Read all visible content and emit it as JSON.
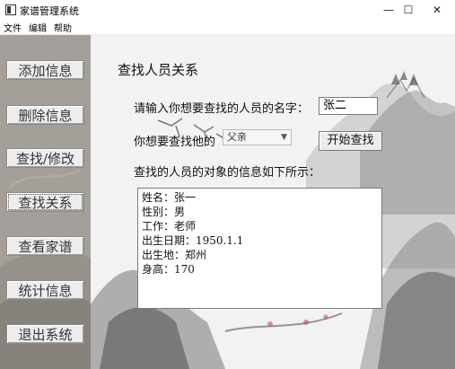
{
  "window": {
    "title": "家谱管理系统",
    "minimize": "—",
    "maximize": "☐",
    "close": "✕"
  },
  "menu": [
    "文件",
    "编辑",
    "帮助"
  ],
  "sidebar": {
    "buttons": [
      "添加信息",
      "删除信息",
      "查找/修改",
      "查找关系",
      "查看家谱",
      "统计信息",
      "退出系统"
    ],
    "active_index": 3
  },
  "main": {
    "page_title": "查找人员关系",
    "name_prompt": "请输入你想要查找的人员的名字：",
    "name_value": "张二",
    "relation_prompt": "你想要查找他的",
    "relation_selected": "父亲",
    "start_button": "开始查找",
    "result_caption": "查找的人员的对象的信息如下所示：",
    "result_lines": [
      "姓名：张一",
      "性别：男",
      "工作：老师",
      "出生日期：1950.1.1",
      "出生地：郑州",
      "身高：170"
    ]
  },
  "icons": {
    "app": "app-icon",
    "dropdown": "chevron-down-icon"
  }
}
